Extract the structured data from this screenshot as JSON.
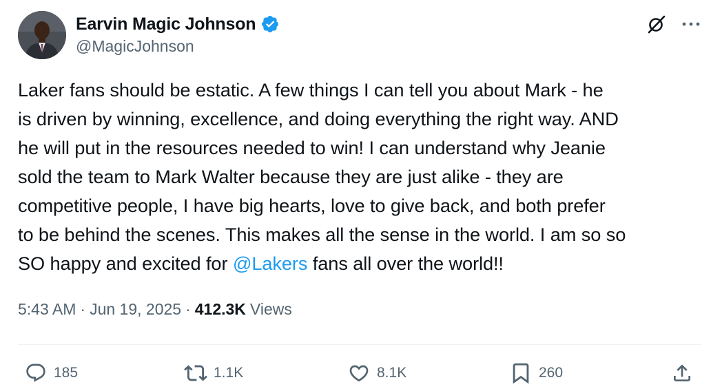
{
  "author": {
    "display_name": "Earvin Magic Johnson",
    "handle": "@MagicJohnson",
    "verified_icon": "verified-badge-icon",
    "avatar": "profile-photo"
  },
  "header_actions": {
    "grok_icon": "grok-icon",
    "more_icon": "more-dots-icon"
  },
  "tweet": {
    "lines": [
      "Laker fans should be estatic. A few things I can tell you about Mark - he",
      "is driven by winning, excellence, and doing everything the right way. AND",
      "he will put in the resources needed to win! I can understand why Jeanie",
      "sold the team to Mark Walter because they are just alike - they are",
      "competitive people, I have big hearts, love to give back, and both prefer",
      "to be behind the scenes. This makes all the sense in the world. I am so so"
    ],
    "last_line_before": "SO happy and excited for ",
    "mention": "@Lakers",
    "last_line_after": " fans all over the world!!"
  },
  "meta": {
    "time": "5:43 AM",
    "separator": "·",
    "date": "Jun 19, 2025",
    "views_count": "412.3K",
    "views_label": "Views"
  },
  "actions": {
    "replies": "185",
    "reposts": "1.1K",
    "likes": "8.1K",
    "bookmarks": "260"
  },
  "colors": {
    "accent": "#1d9bf0",
    "text": "#0f1419",
    "secondary": "#536471"
  }
}
